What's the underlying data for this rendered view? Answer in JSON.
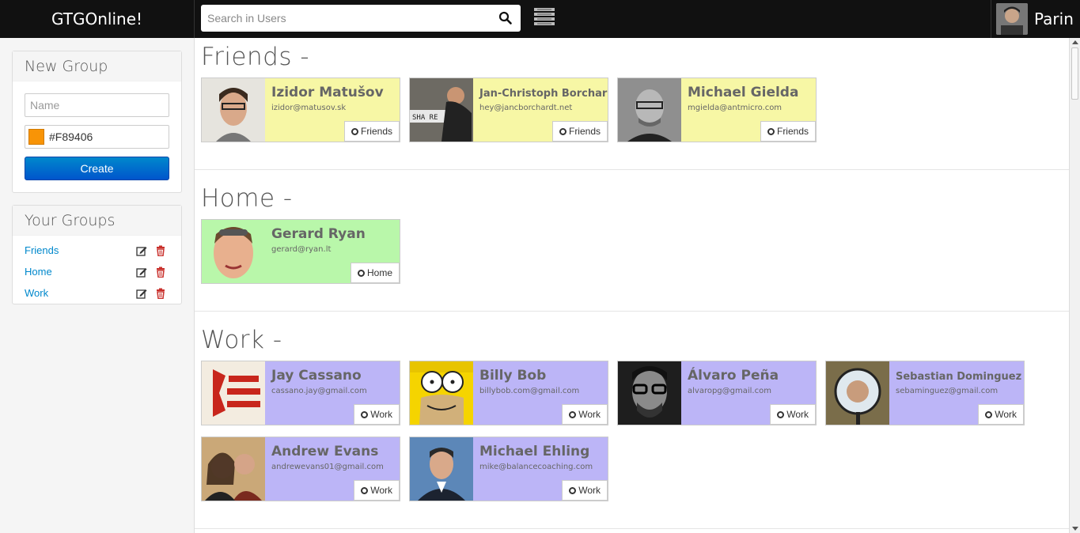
{
  "app": {
    "title": "GTGOnline!"
  },
  "search": {
    "placeholder": "Search in Users"
  },
  "user": {
    "name": "Parin"
  },
  "sidebar": {
    "new_group": {
      "title": "New Group",
      "name_placeholder": "Name",
      "color_value": "#F89406",
      "create_label": "Create"
    },
    "your_groups": {
      "title": "Your Groups",
      "items": [
        {
          "label": "Friends"
        },
        {
          "label": "Home"
        },
        {
          "label": "Work"
        }
      ]
    }
  },
  "sections": [
    {
      "title": "Friends -",
      "color": "#f7f7a5",
      "contacts": [
        {
          "name": "Izidor Matušov",
          "email": "izidor@matusov.sk",
          "group": "Friends"
        },
        {
          "name": "Jan-Christoph Borchar",
          "email": "hey@jancborchardt.net",
          "group": "Friends"
        },
        {
          "name": "Michael Gielda",
          "email": "mgielda@antmicro.com",
          "group": "Friends"
        }
      ]
    },
    {
      "title": "Home -",
      "color": "#b9f7aa",
      "contacts": [
        {
          "name": "Gerard Ryan",
          "email": "gerard@ryan.lt",
          "group": "Home"
        }
      ]
    },
    {
      "title": "Work -",
      "color": "#bcb5f7",
      "contacts": [
        {
          "name": "Jay Cassano",
          "email": "cassano.jay@gmail.com",
          "group": "Work"
        },
        {
          "name": "Billy Bob",
          "email": "billybob.com@gmail.com",
          "group": "Work"
        },
        {
          "name": "Álvaro Peña",
          "email": "alvaropg@gmail.com",
          "group": "Work"
        },
        {
          "name": "Sebastian Dominguez",
          "email": "sebaminguez@gmail.com",
          "group": "Work"
        },
        {
          "name": "Andrew Evans",
          "email": "andrewevans01@gmail.com",
          "group": "Work"
        },
        {
          "name": "Michael Ehling",
          "email": "mike@balancecoaching.com",
          "group": "Work"
        }
      ]
    }
  ]
}
